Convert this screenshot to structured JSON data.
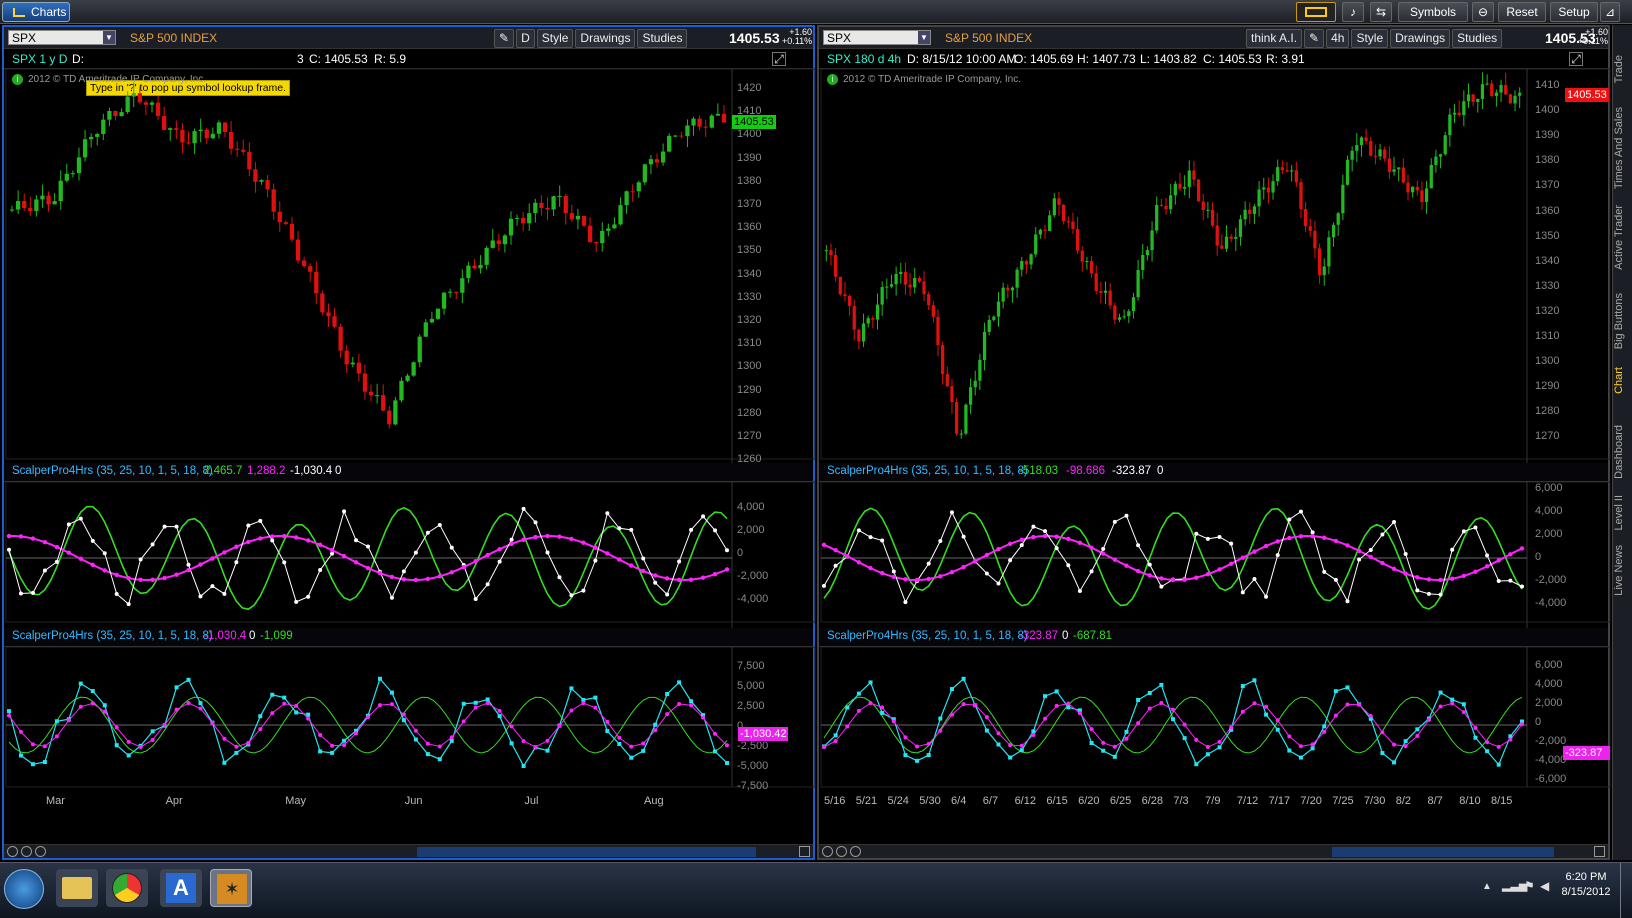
{
  "app": {
    "tab_label": "Charts",
    "toolbar": [
      "Symbols",
      "Reset",
      "Setup"
    ]
  },
  "left": {
    "symbol": "SPX",
    "description": "S&P 500 INDEX",
    "agg": "D",
    "buttons": [
      "Style",
      "Drawings",
      "Studies"
    ],
    "last": "1405.53",
    "change": "+1.60",
    "change_pct": "+0.11%",
    "info_label": "SPX 1 y D",
    "info_d": "D:",
    "info_close": "C: 1405.53",
    "info_range": "R: 5.9",
    "info_hidden": "3",
    "tooltip": "Type in '?' to pop up symbol lookup frame.",
    "copyright": "2012 © TD Ameritrade IP Company, Inc.",
    "price_ticks": [
      "1420",
      "1410",
      "1400",
      "1390",
      "1380",
      "1370",
      "1360",
      "1350",
      "1340",
      "1330",
      "1320",
      "1310",
      "1300",
      "1290",
      "1280",
      "1270",
      "1260"
    ],
    "price_tag": "1405.53",
    "study1": {
      "name": "ScalperPro4Hrs (35, 25, 10, 1, 5, 18, 8)",
      "v1": "2,465.7",
      "v2": "1,288.2",
      "v3": "-1,030.4",
      "v4": "0",
      "ticks": [
        "4,000",
        "2,000",
        "0",
        "-2,000",
        "-4,000"
      ]
    },
    "study2": {
      "name": "ScalperPro4Hrs (35, 25, 10, 1, 5, 18, 8)",
      "v1": "-1,030.4",
      "v2": "0",
      "v3": "-1,099",
      "ticks": [
        "7,500",
        "5,000",
        "2,500",
        "0",
        "-2,500",
        "-5,000",
        "-7,500"
      ],
      "tag": "-1,030.42"
    },
    "xlabels": [
      "Mar",
      "Apr",
      "May",
      "Jun",
      "Jul",
      "Aug"
    ]
  },
  "right": {
    "symbol": "SPX",
    "description": "S&P 500 INDEX",
    "agg": "4h",
    "think": "think A.I.",
    "buttons": [
      "Style",
      "Drawings",
      "Studies"
    ],
    "last": "1405.53",
    "change": "+1.60",
    "change_pct": "+0.11%",
    "info_label": "SPX 180 d 4h",
    "info_d": "D: 8/15/12 10:00 AM",
    "info_o": "O: 1405.69",
    "info_h": "H: 1407.73",
    "info_l": "L: 1403.82",
    "info_c": "C: 1405.53",
    "info_r": "R: 3.91",
    "copyright": "2012 © TD Ameritrade IP Company, Inc.",
    "price_ticks": [
      "1410",
      "1400",
      "1390",
      "1380",
      "1370",
      "1360",
      "1350",
      "1340",
      "1330",
      "1320",
      "1310",
      "1300",
      "1290",
      "1280",
      "1270"
    ],
    "price_tag": "1405.53",
    "study1": {
      "name": "ScalperPro4Hrs (35, 25, 10, 1, 5, 18, 8)",
      "v1": "-518.03",
      "v2": "-98.686",
      "v3": "-323.87",
      "v4": "0",
      "ticks": [
        "6,000",
        "4,000",
        "2,000",
        "0",
        "-2,000",
        "-4,000"
      ]
    },
    "study2": {
      "name": "ScalperPro4Hrs (35, 25, 10, 1, 5, 18, 8)",
      "v1": "-323.87",
      "v2": "0",
      "v3": "-687.81",
      "ticks": [
        "6,000",
        "4,000",
        "2,000",
        "0",
        "-2,000",
        "-4,000",
        "-6,000"
      ],
      "tag": "-323.87"
    },
    "xlabels": [
      "5/16",
      "5/21",
      "5/24",
      "5/30",
      "6/4",
      "6/7",
      "6/12",
      "6/15",
      "6/20",
      "6/25",
      "6/28",
      "7/3",
      "7/9",
      "7/12",
      "7/17",
      "7/20",
      "7/25",
      "7/30",
      "8/2",
      "8/7",
      "8/10",
      "8/15"
    ]
  },
  "sidebar": [
    "Trade",
    "Times And Sales",
    "Active Trader",
    "Big Buttons",
    "Chart",
    "Dashboard",
    "Level II",
    "Live News"
  ],
  "clock": {
    "time": "6:20 PM",
    "date": "8/15/2012"
  },
  "colors": {
    "up": "#22b822",
    "down": "#e01010",
    "magenta": "#ff22ff",
    "cyan": "#22e6f0",
    "green": "#33dd22",
    "accent": "#1a5fd0"
  }
}
